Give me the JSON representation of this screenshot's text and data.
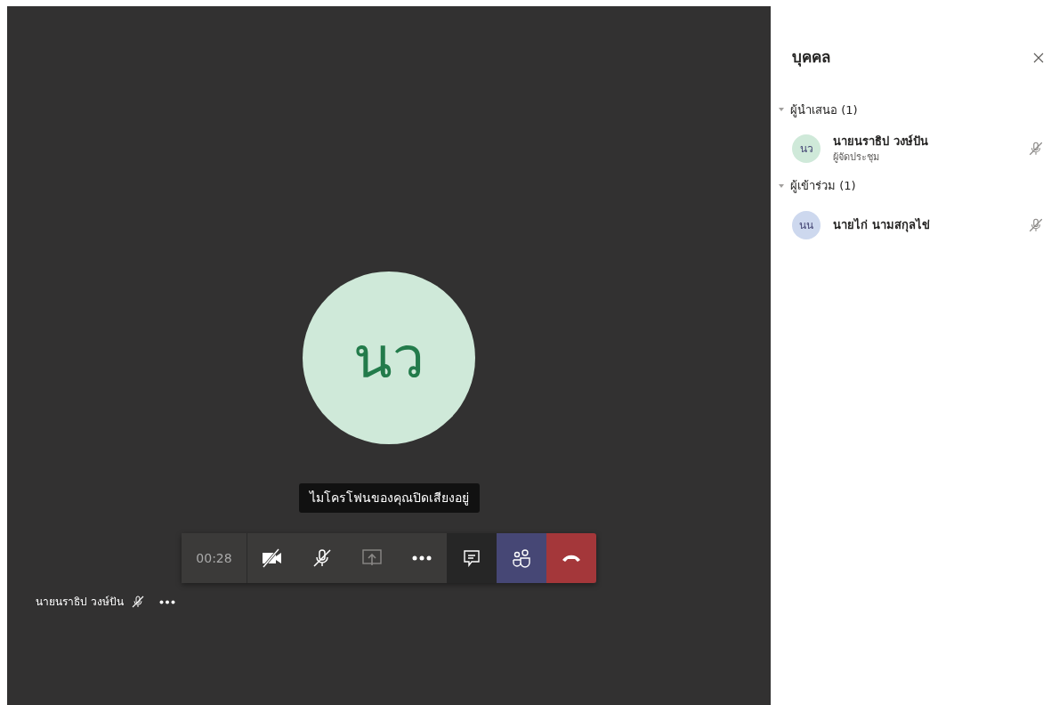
{
  "stage": {
    "avatar": {
      "initials": "นว",
      "color": "#cfe9d9"
    },
    "tooltip": "ไมโครโฟนของคุณปิดเสียงอยู่",
    "toolbar": {
      "timer": "00:28",
      "buttons": [
        {
          "kind": "camera",
          "off": true,
          "selected": false
        },
        {
          "kind": "mic",
          "off": true,
          "selected": false
        },
        {
          "kind": "share",
          "selected": false,
          "disabled": true
        },
        {
          "kind": "more",
          "selected": false
        },
        {
          "kind": "chat",
          "selected": false
        },
        {
          "kind": "people",
          "selected": true
        },
        {
          "kind": "hangup"
        }
      ]
    },
    "self_label": {
      "name": "นายนราธิป วงษ์ปัน",
      "muted": true
    }
  },
  "panel": {
    "title": "บุคคล",
    "groups": [
      {
        "label": "ผู้นำเสนอ (1)",
        "expanded": true,
        "people": [
          {
            "initials": "นว",
            "name": "นายนราธิป วงษ์ปัน",
            "role": "ผู้จัดประชุม",
            "color": "#cfe9d9",
            "muted": true
          }
        ]
      },
      {
        "label": "ผู้เข้าร่วม (1)",
        "expanded": true,
        "people": [
          {
            "initials": "นน",
            "name": "นายไก่ นามสกุลไข่",
            "color": "#cdd8ee",
            "muted": true
          }
        ]
      }
    ]
  }
}
